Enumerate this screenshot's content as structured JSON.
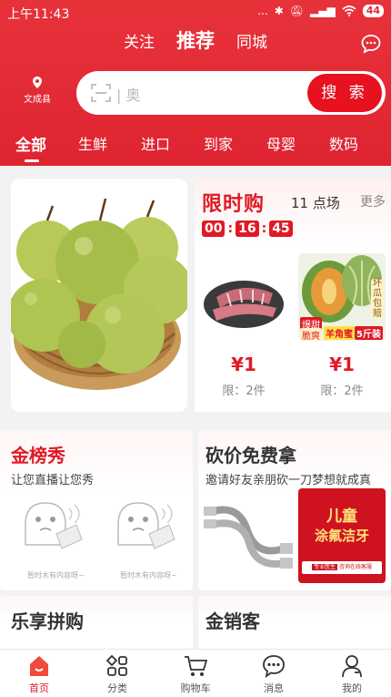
{
  "status": {
    "time": "上午11:43",
    "signal": "...",
    "battery": "44"
  },
  "topnav": {
    "tabs": [
      {
        "label": "关注"
      },
      {
        "label": "推荐"
      },
      {
        "label": "同城"
      }
    ]
  },
  "location": {
    "label": "文成县"
  },
  "search": {
    "placeholder": "奥",
    "button": "搜 索"
  },
  "categories": [
    {
      "label": "全部"
    },
    {
      "label": "生鲜"
    },
    {
      "label": "进口"
    },
    {
      "label": "到家"
    },
    {
      "label": "母婴"
    },
    {
      "label": "数码"
    }
  ],
  "flash_sale": {
    "title": "限时购",
    "round": "11 点场",
    "more": "更多",
    "countdown": {
      "h": "00",
      "m": "16",
      "s": "45"
    },
    "products": [
      {
        "price": "¥1",
        "limit": "限：2件"
      },
      {
        "price": "¥1",
        "limit": "限：2件",
        "tags": [
          "爆甜",
          "脆爽",
          "羊角蜜",
          "5斤装"
        ],
        "side_tag": "坏瓜包赔"
      }
    ]
  },
  "cards": {
    "jinbang": {
      "title": "金榜秀",
      "subtitle": "让您直播让您秀",
      "empty1": "暂时木有内容呀~",
      "empty2": "暂时木有内容呀~"
    },
    "kanjia": {
      "title": "砍价免费拿",
      "subtitle": "邀请好友亲朋砍一刀梦想就成真",
      "ad_line1": "儿童",
      "ad_line2": "涂氟洁牙",
      "ad_foot1": "专业医生",
      "ad_foot2": "咨询在线客服"
    },
    "lexiang": {
      "title": "乐享拼购"
    },
    "jinxiao": {
      "title": "金销客"
    }
  },
  "tabbar": [
    {
      "label": "首页"
    },
    {
      "label": "分类"
    },
    {
      "label": "购物车"
    },
    {
      "label": "消息"
    },
    {
      "label": "我的"
    }
  ],
  "colors": {
    "brand": "#e22a35",
    "accent_red": "#e01a25",
    "gold": "#8a5a10"
  }
}
